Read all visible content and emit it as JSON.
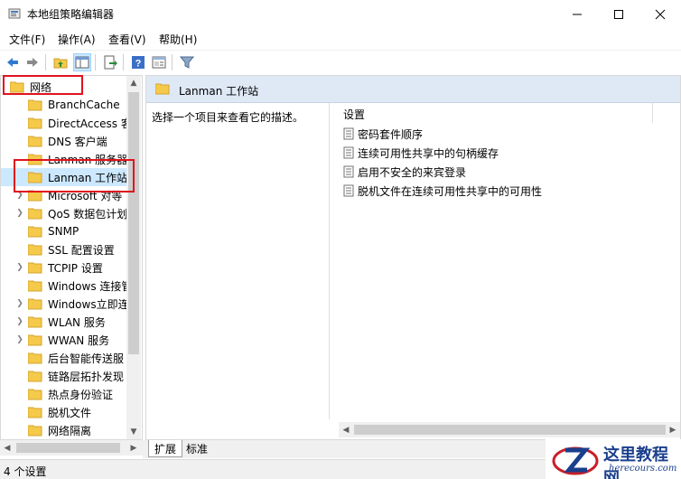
{
  "window": {
    "title": "本地组策略编辑器",
    "minimize_icon": "minimize-icon",
    "maximize_icon": "maximize-icon",
    "close_icon": "close-icon"
  },
  "menu": {
    "file": "文件(F)",
    "action": "操作(A)",
    "view": "查看(V)",
    "help": "帮助(H)"
  },
  "toolbar": {
    "icons": [
      "back-icon",
      "forward-icon",
      "up-folder-icon",
      "show-hide-tree-icon",
      "export-list-icon",
      "help-icon",
      "properties-icon",
      "filter-icon"
    ]
  },
  "tree": {
    "root": "网络",
    "items": [
      {
        "label": "BranchCache",
        "expandable": false
      },
      {
        "label": "DirectAccess 客",
        "expandable": false
      },
      {
        "label": "DNS 客户端",
        "expandable": false
      },
      {
        "label": "Lanman 服务器",
        "expandable": false
      },
      {
        "label": "Lanman 工作站",
        "expandable": false,
        "selected": true
      },
      {
        "label": "Microsoft 对等",
        "expandable": true
      },
      {
        "label": "QoS 数据包计划",
        "expandable": true
      },
      {
        "label": "SNMP",
        "expandable": false
      },
      {
        "label": "SSL 配置设置",
        "expandable": false
      },
      {
        "label": "TCPIP 设置",
        "expandable": true
      },
      {
        "label": "Windows 连接管",
        "expandable": false
      },
      {
        "label": "Windows立即连",
        "expandable": true
      },
      {
        "label": "WLAN 服务",
        "expandable": true
      },
      {
        "label": "WWAN 服务",
        "expandable": true
      },
      {
        "label": "后台智能传送服",
        "expandable": false
      },
      {
        "label": "链路层拓扑发现",
        "expandable": false
      },
      {
        "label": "热点身份验证",
        "expandable": false
      },
      {
        "label": "脱机文件",
        "expandable": false
      },
      {
        "label": "网络隔离",
        "expandable": false
      }
    ]
  },
  "right_pane": {
    "header_title": "Lanman 工作站",
    "description": "选择一个项目来查看它的描述。",
    "settings_column": "设置",
    "settings": [
      "密码套件顺序",
      "连续可用性共享中的句柄缓存",
      "启用不安全的来宾登录",
      "脱机文件在连续可用性共享中的可用性"
    ]
  },
  "tabs": {
    "extended": "扩展",
    "standard": "标准"
  },
  "status": {
    "text": "4 个设置"
  },
  "watermark": {
    "title": "这里教程网",
    "url": "herecours.com"
  },
  "colors": {
    "highlight": "#e0141e",
    "folder": "#f5c94a",
    "header_bg": "#dfe9f5"
  }
}
